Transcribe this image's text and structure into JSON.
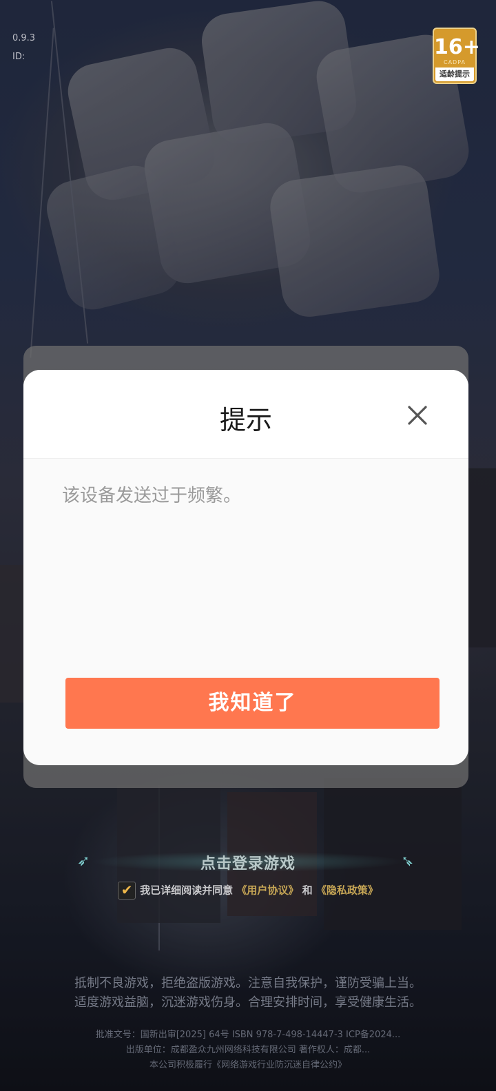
{
  "version": {
    "line1": "0.9.3",
    "line2": "ID:"
  },
  "age_badge": {
    "rating": "16+",
    "org": "CADPA",
    "tip": "适龄提示",
    "color": "#d59a2c"
  },
  "login": {
    "label": "点击登录游戏",
    "agree_prefix": "我已详细阅读并同意",
    "user_agreement": "《用户协议》",
    "and": "和",
    "privacy_policy": "《隐私政策》",
    "checked": true
  },
  "health_notice": {
    "line1": "抵制不良游戏，拒绝盗版游戏。注意自我保护，谨防受骗上当。",
    "line2": "适度游戏益脑，沉迷游戏伤身。合理安排时间，享受健康生活。"
  },
  "legal": {
    "line1": "批准文号：国新出审[2025] 64号 ISBN 978-7-498-14447-3 ICP备2024...",
    "line2": "出版单位：成都盈众九州网络科技有限公司 著作权人：成都...",
    "line3": "本公司积极履行《网络游戏行业防沉迷自律公约》"
  },
  "dialog": {
    "title": "提示",
    "close_icon": "close-icon",
    "message": "该设备发送过于频繁。",
    "confirm_label": "我知道了",
    "accent": "#ff774f"
  }
}
